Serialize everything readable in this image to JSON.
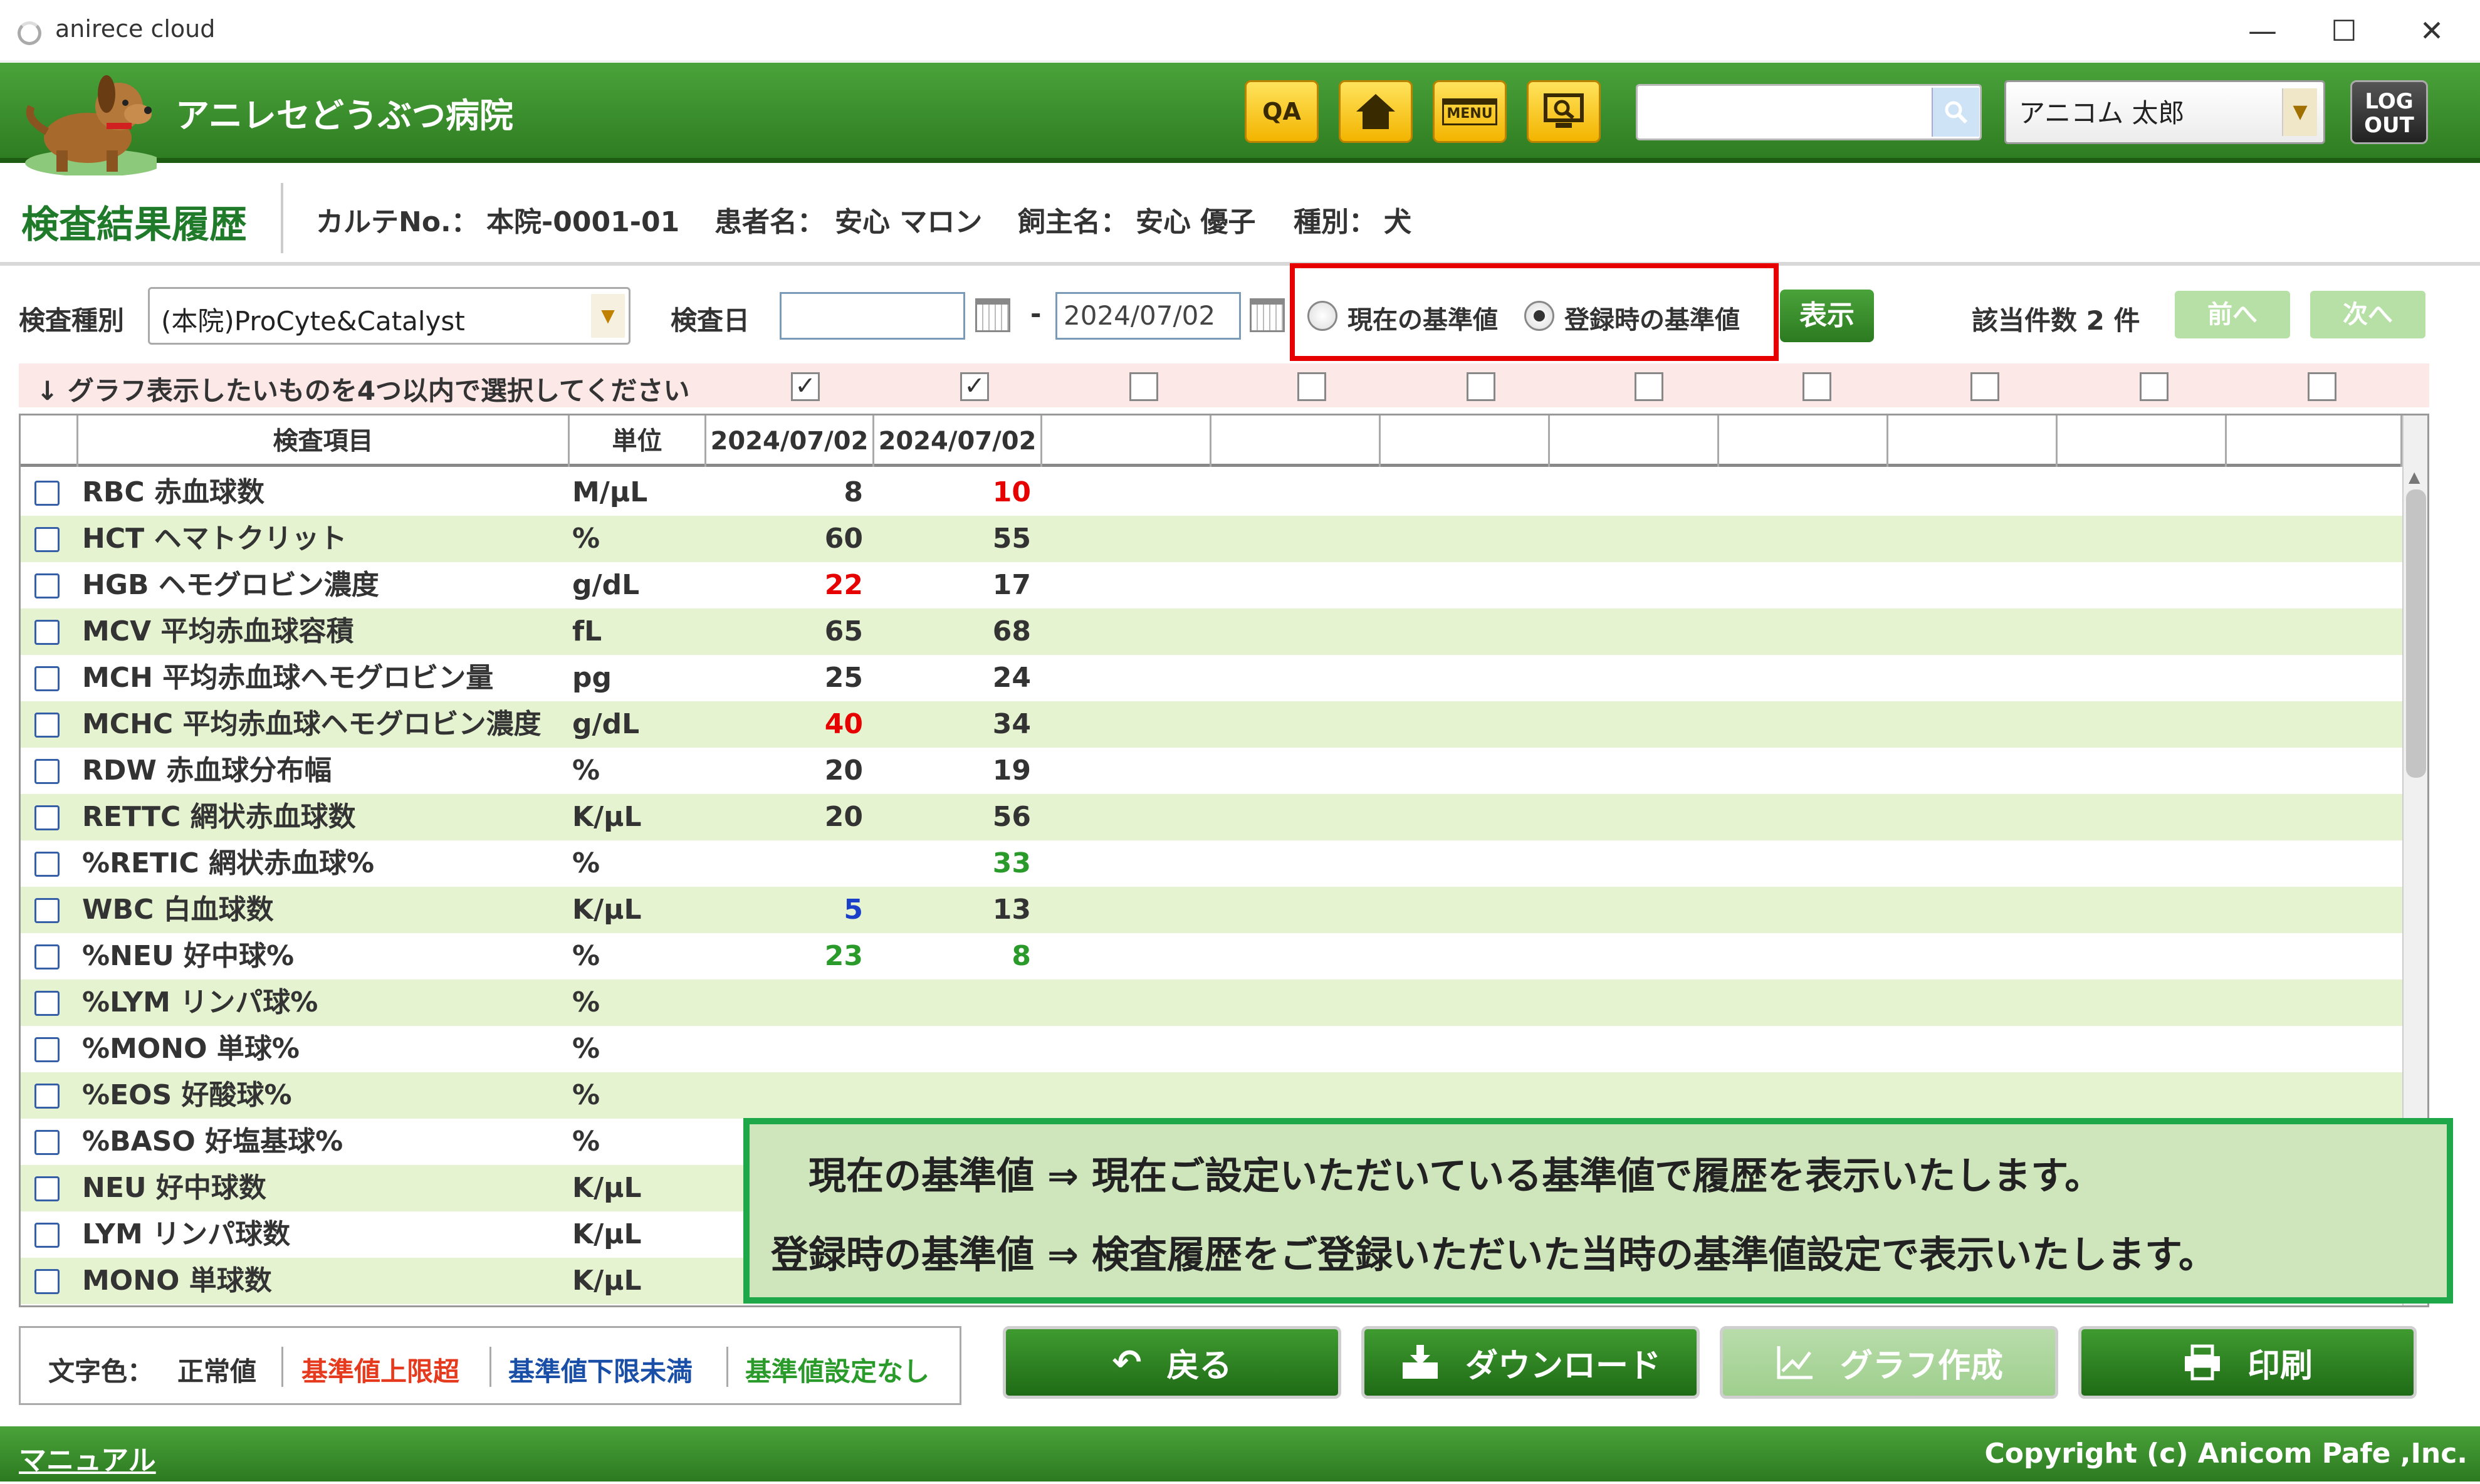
{
  "window": {
    "title": "anirece cloud",
    "minimize": "—",
    "maximize": "☐",
    "close": "✕"
  },
  "header": {
    "hospital_name": "アニレセどうぶつ病院",
    "qa_label": "QA",
    "menu_label": "MENU",
    "logout_line1": "LOG",
    "logout_line2": "OUT",
    "user_name": "アニコム 太郎",
    "search_value": ""
  },
  "patient": {
    "page_title": "検査結果履歴",
    "karte_label": "カルテNo.：",
    "karte_value": "本院-0001-01",
    "patient_label": "患者名：",
    "patient_value": "安心 マロン",
    "owner_label": "飼主名：",
    "owner_value": "安心 優子",
    "species_label": "種別：",
    "species_value": "犬"
  },
  "filter": {
    "exam_type_label": "検査種別",
    "exam_type_value": "(本院)ProCyte&Catalyst",
    "exam_date_label": "検査日",
    "date_from": "",
    "date_sep": "-",
    "date_to": "2024/07/02",
    "radio_current": "現在の基準値",
    "radio_registered": "登録時の基準値",
    "selected_radio": "registered",
    "show_button": "表示",
    "count_text": "該当件数 2 件",
    "prev_button": "前へ",
    "next_button": "次へ"
  },
  "graph_select": {
    "message": "↓ グラフ表示したいものを4つ以内で選択してください",
    "checks": [
      true,
      true,
      false,
      false,
      false,
      false,
      false,
      false,
      false,
      false
    ]
  },
  "table": {
    "headers": {
      "item": "検査項目",
      "unit": "単位",
      "col1": "2024/07/02",
      "col2": "2024/07/02"
    },
    "rows": [
      {
        "item": "RBC 赤血球数",
        "unit": "M/μL",
        "v1": "8",
        "c1": "normal",
        "v2": "10",
        "c2": "high"
      },
      {
        "item": "HCT ヘマトクリット",
        "unit": "%",
        "v1": "60",
        "c1": "normal",
        "v2": "55",
        "c2": "normal"
      },
      {
        "item": "HGB ヘモグロビン濃度",
        "unit": "g/dL",
        "v1": "22",
        "c1": "high",
        "v2": "17",
        "c2": "normal"
      },
      {
        "item": "MCV 平均赤血球容積",
        "unit": "fL",
        "v1": "65",
        "c1": "normal",
        "v2": "68",
        "c2": "normal"
      },
      {
        "item": "MCH 平均赤血球ヘモグロビン量",
        "unit": "pg",
        "v1": "25",
        "c1": "normal",
        "v2": "24",
        "c2": "normal"
      },
      {
        "item": "MCHC 平均赤血球ヘモグロビン濃度",
        "unit": "g/dL",
        "v1": "40",
        "c1": "high",
        "v2": "34",
        "c2": "normal"
      },
      {
        "item": "RDW 赤血球分布幅",
        "unit": "%",
        "v1": "20",
        "c1": "normal",
        "v2": "19",
        "c2": "normal"
      },
      {
        "item": "RETTC 網状赤血球数",
        "unit": "K/μL",
        "v1": "20",
        "c1": "normal",
        "v2": "56",
        "c2": "normal"
      },
      {
        "item": "%RETIC 網状赤血球%",
        "unit": "%",
        "v1": "",
        "c1": "normal",
        "v2": "33",
        "c2": "none"
      },
      {
        "item": "WBC 白血球数",
        "unit": "K/μL",
        "v1": "5",
        "c1": "low",
        "v2": "13",
        "c2": "normal"
      },
      {
        "item": "%NEU 好中球%",
        "unit": "%",
        "v1": "23",
        "c1": "none",
        "v2": "8",
        "c2": "none"
      },
      {
        "item": "%LYM リンパ球%",
        "unit": "%",
        "v1": "",
        "c1": "normal",
        "v2": "",
        "c2": "normal"
      },
      {
        "item": "%MONO 単球%",
        "unit": "%",
        "v1": "",
        "c1": "normal",
        "v2": "",
        "c2": "normal"
      },
      {
        "item": "%EOS 好酸球%",
        "unit": "%",
        "v1": "",
        "c1": "normal",
        "v2": "",
        "c2": "normal"
      },
      {
        "item": "%BASO 好塩基球%",
        "unit": "%",
        "v1": "",
        "c1": "normal",
        "v2": "",
        "c2": "normal"
      },
      {
        "item": "NEU 好中球数",
        "unit": "K/μL",
        "v1": "",
        "c1": "normal",
        "v2": "",
        "c2": "normal"
      },
      {
        "item": "LYM リンパ球数",
        "unit": "K/μL",
        "v1": "",
        "c1": "normal",
        "v2": "",
        "c2": "normal"
      },
      {
        "item": "MONO 単球数",
        "unit": "K/μL",
        "v1": "",
        "c1": "normal",
        "v2": "",
        "c2": "normal"
      }
    ]
  },
  "callout": {
    "line1": "現在の基準値 ⇒ 現在ご設定いただいている基準値で履歴を表示いたします。",
    "line2": "登録時の基準値 ⇒ 検査履歴をご登録いただいた当時の基準値設定で表示いたします。"
  },
  "legend": {
    "label": "文字色：",
    "normal": "正常値",
    "high": "基準値上限超",
    "low": "基準値下限未満",
    "none": "基準値設定なし"
  },
  "buttons": {
    "back": "戻る",
    "download": "ダウンロード",
    "graph": "グラフ作成",
    "print": "印刷"
  },
  "footer": {
    "manual": "マニュアル",
    "copyright": "Copyright (c) Anicom Pafe ,Inc."
  },
  "colors": {
    "normal": "#333333",
    "high": "#e60000",
    "low": "#1a3fc8",
    "none": "#2a9a2a",
    "brand_green": "#2f7d22"
  }
}
